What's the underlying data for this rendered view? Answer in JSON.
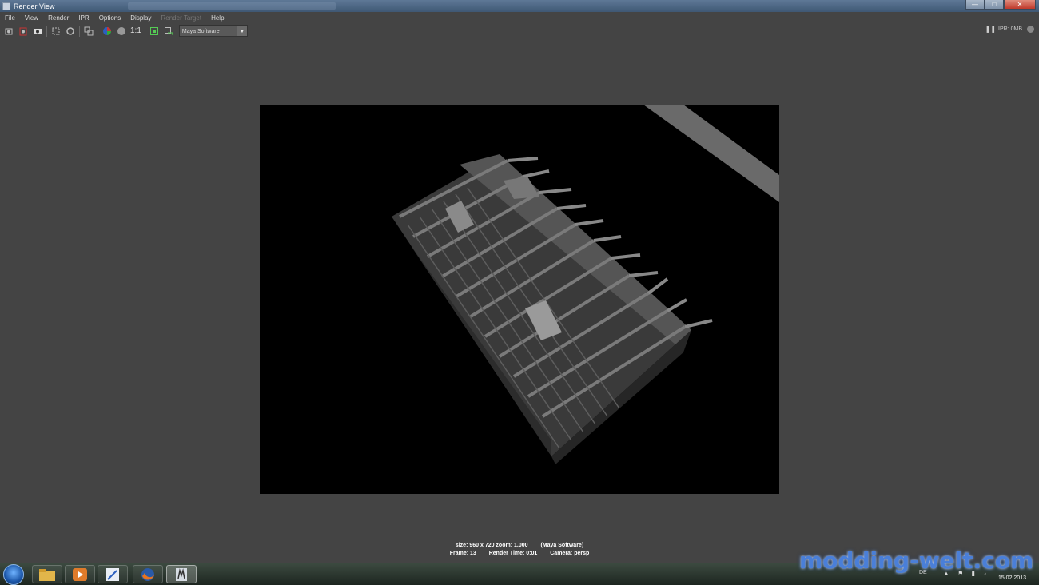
{
  "window": {
    "title": "Render View",
    "controls": {
      "minimize": "—",
      "maximize": "□",
      "close": "✕"
    }
  },
  "menu": [
    {
      "label": "File",
      "enabled": true
    },
    {
      "label": "View",
      "enabled": true
    },
    {
      "label": "Render",
      "enabled": true
    },
    {
      "label": "IPR",
      "enabled": true
    },
    {
      "label": "Options",
      "enabled": true
    },
    {
      "label": "Display",
      "enabled": true
    },
    {
      "label": "Render Target",
      "enabled": false
    },
    {
      "label": "Help",
      "enabled": true
    }
  ],
  "toolbar": {
    "buttons": [
      {
        "name": "redo-render-icon",
        "glyph": "⟳"
      },
      {
        "name": "ipr-render-icon",
        "glyph": "◉"
      },
      {
        "name": "snapshot-icon",
        "glyph": "▣"
      },
      {
        "name": "render-region-icon",
        "glyph": "⬚"
      },
      {
        "name": "refresh-icon",
        "glyph": "↻"
      },
      {
        "name": "keep-image-icon",
        "glyph": "⧉"
      },
      {
        "name": "rgb-channels-icon",
        "glyph": "●"
      },
      {
        "name": "alpha-channel-icon",
        "glyph": "●"
      },
      {
        "name": "ratio-1to1-label",
        "glyph": "1:1"
      },
      {
        "name": "display-real-size-icon",
        "glyph": "▢"
      },
      {
        "name": "export-icon",
        "glyph": "⇲"
      }
    ],
    "ratio_label": "1:1",
    "renderer": "Maya Software",
    "ipr_memory": "IPR: 0MB"
  },
  "render_info": {
    "size": "size: 960 x 720 zoom: 1.000",
    "renderer": "(Maya Software)",
    "frame": "Frame: 13",
    "render_time": "Render Time: 0:01",
    "camera": "Camera: persp"
  },
  "taskbar": {
    "apps": [
      "explorer-icon",
      "media-player-icon",
      "paint-icon",
      "firefox-icon",
      "maya-icon"
    ],
    "language": "DE",
    "date": "15.02.2013"
  },
  "watermark": "modding-welt.com",
  "colors": {
    "ui_background": "#444444",
    "render_background": "#000000",
    "watermark": "#4a7fd8"
  }
}
